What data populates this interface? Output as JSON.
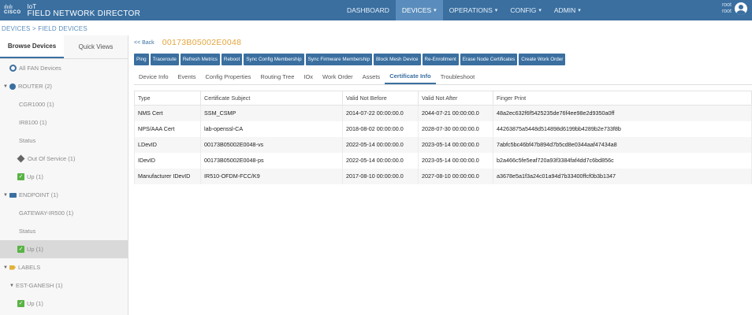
{
  "app": {
    "brand": "cisco",
    "brand_bars": "ılıılı",
    "product_prefix": "IoT",
    "product_name": "FIELD NETWORK DIRECTOR"
  },
  "topnav": {
    "items": [
      {
        "label": "DASHBOARD",
        "caret": ""
      },
      {
        "label": "DEVICES",
        "caret": "▾"
      },
      {
        "label": "OPERATIONS",
        "caret": "▾"
      },
      {
        "label": "CONFIG",
        "caret": "▾"
      },
      {
        "label": "ADMIN",
        "caret": "▾"
      }
    ],
    "active": "DEVICES"
  },
  "user": {
    "name": "root",
    "role": "root"
  },
  "breadcrumb": "DEVICES > FIELD DEVICES",
  "sidebar": {
    "tabs": [
      "Browse Devices",
      "Quick Views"
    ],
    "tree": [
      {
        "label": "All FAN Devices",
        "icon": "fan-icon"
      },
      {
        "label": "ROUTER (2)",
        "icon": "router-globe-icon"
      },
      {
        "label": "CGR1000 (1)",
        "icon": ""
      },
      {
        "label": "IR8100 (1)",
        "icon": ""
      },
      {
        "label": "Status",
        "icon": ""
      },
      {
        "label": "Out Of Service (1)",
        "icon": "out-of-service-icon"
      },
      {
        "label": "Up (1)",
        "icon": "check-icon"
      },
      {
        "label": "ENDPOINT (1)",
        "icon": "endpoint-icon"
      },
      {
        "label": "GATEWAY-IR500 (1)",
        "icon": ""
      },
      {
        "label": "Status",
        "icon": ""
      },
      {
        "label": "Up (1)",
        "icon": "check-icon"
      },
      {
        "label": "LABELS",
        "icon": "tag-icon"
      },
      {
        "label": "EST-GANESH (1)",
        "icon": ""
      },
      {
        "label": "Up (1)",
        "icon": "check-icon"
      }
    ]
  },
  "main": {
    "back_label": "<< Back",
    "device_id": "00173B05002E0048",
    "actions": [
      "Ping",
      "Traceroute",
      "Refresh Metrics",
      "Reboot",
      "Sync Config Membership",
      "Sync Firmware Membership",
      "Block Mesh Device",
      "Re-Enrollment",
      "Erase Node Certificates",
      "Create Work Order"
    ],
    "tabs": [
      "Device Info",
      "Events",
      "Config Properties",
      "Routing Tree",
      "IOx",
      "Work Order",
      "Assets",
      "Certificate Info",
      "Troubleshoot"
    ],
    "active_tab": "Certificate Info",
    "table": {
      "headers": [
        "Type",
        "Certificate Subject",
        "Valid Not Before",
        "Valid Not After",
        "Finger Print"
      ],
      "rows": [
        [
          "NMS Cert",
          "SSM_CSMP",
          "2014-07-22 00:00:00.0",
          "2044-07-21 00:00:00.0",
          "48a2ec632f6f5425235de76f4ee98e2d9350a0ff"
        ],
        [
          "NPS/AAA Cert",
          "lab-openssl-CA",
          "2018-08-02 00:00:00.0",
          "2028-07-30 00:00:00.0",
          "44263875a5448d514898d6199bb4289b2e733f8b"
        ],
        [
          "LDevID",
          "00173B05002E0048-vs",
          "2022-05-14 00:00:00.0",
          "2023-05-14 00:00:00.0",
          "7abfc5bc46bf47b894d7b5cd8e0344aaf47434a8"
        ],
        [
          "IDevID",
          "00173B05002E0048-ps",
          "2022-05-14 00:00:00.0",
          "2023-05-14 00:00:00.0",
          "b2a466c5fe5eaf720a93f3384faf4dd7c6bd856c"
        ],
        [
          "Manufacturer IDevID",
          "IR510-OFDM-FCC/K9",
          "2017-08-10 00:00:00.0",
          "2027-08-10 00:00:00.0",
          "a3678e5a1f3a24c01a94d7b33400ffcf0b3b1347"
        ]
      ]
    }
  },
  "colors": {
    "header_bg": "#3a6fa0",
    "accent_orange": "#e4a43a",
    "status_green": "#59b345"
  }
}
